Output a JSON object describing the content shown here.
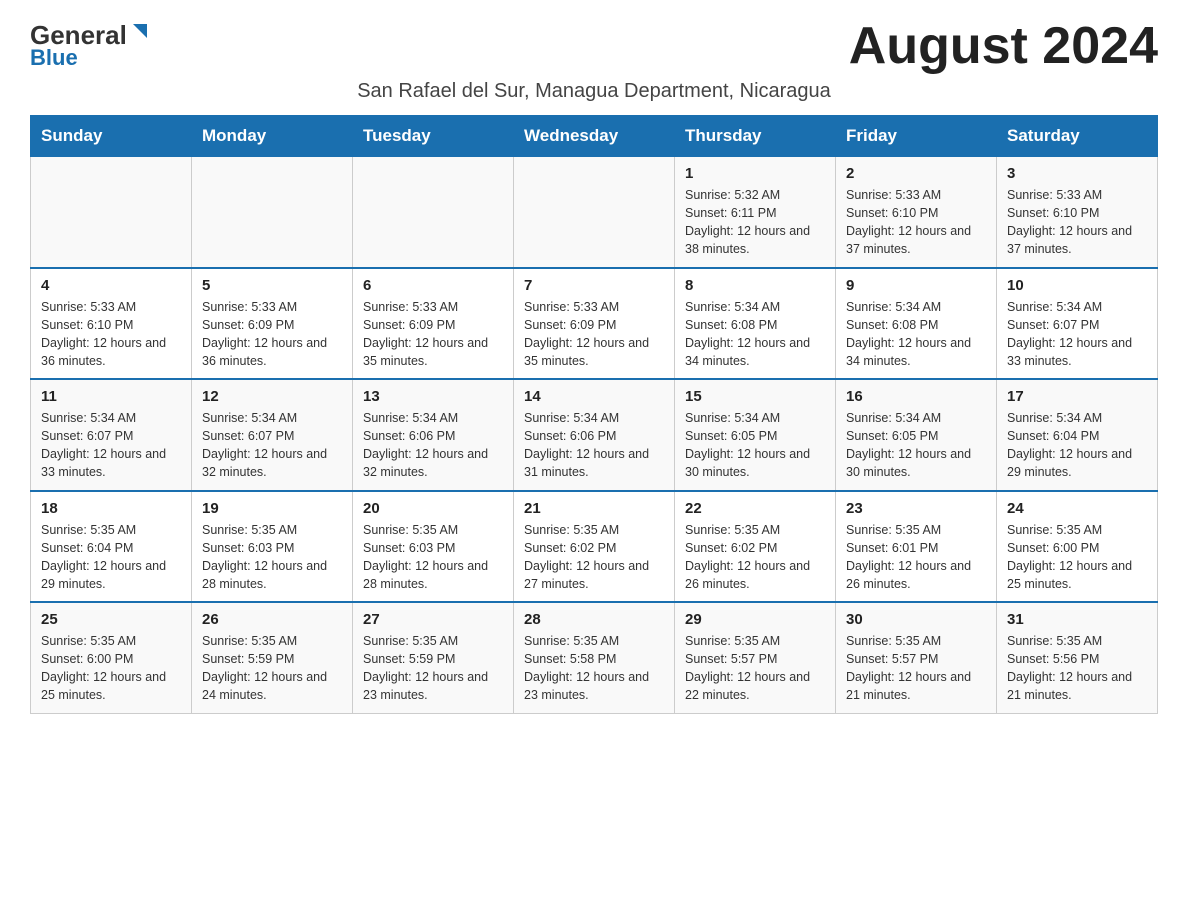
{
  "logo": {
    "general": "General",
    "blue": "Blue",
    "triangle": "▶"
  },
  "header": {
    "month_year": "August 2024",
    "location": "San Rafael del Sur, Managua Department, Nicaragua"
  },
  "weekdays": [
    "Sunday",
    "Monday",
    "Tuesday",
    "Wednesday",
    "Thursday",
    "Friday",
    "Saturday"
  ],
  "weeks": [
    [
      {
        "day": "",
        "info": ""
      },
      {
        "day": "",
        "info": ""
      },
      {
        "day": "",
        "info": ""
      },
      {
        "day": "",
        "info": ""
      },
      {
        "day": "1",
        "info": "Sunrise: 5:32 AM\nSunset: 6:11 PM\nDaylight: 12 hours and 38 minutes."
      },
      {
        "day": "2",
        "info": "Sunrise: 5:33 AM\nSunset: 6:10 PM\nDaylight: 12 hours and 37 minutes."
      },
      {
        "day": "3",
        "info": "Sunrise: 5:33 AM\nSunset: 6:10 PM\nDaylight: 12 hours and 37 minutes."
      }
    ],
    [
      {
        "day": "4",
        "info": "Sunrise: 5:33 AM\nSunset: 6:10 PM\nDaylight: 12 hours and 36 minutes."
      },
      {
        "day": "5",
        "info": "Sunrise: 5:33 AM\nSunset: 6:09 PM\nDaylight: 12 hours and 36 minutes."
      },
      {
        "day": "6",
        "info": "Sunrise: 5:33 AM\nSunset: 6:09 PM\nDaylight: 12 hours and 35 minutes."
      },
      {
        "day": "7",
        "info": "Sunrise: 5:33 AM\nSunset: 6:09 PM\nDaylight: 12 hours and 35 minutes."
      },
      {
        "day": "8",
        "info": "Sunrise: 5:34 AM\nSunset: 6:08 PM\nDaylight: 12 hours and 34 minutes."
      },
      {
        "day": "9",
        "info": "Sunrise: 5:34 AM\nSunset: 6:08 PM\nDaylight: 12 hours and 34 minutes."
      },
      {
        "day": "10",
        "info": "Sunrise: 5:34 AM\nSunset: 6:07 PM\nDaylight: 12 hours and 33 minutes."
      }
    ],
    [
      {
        "day": "11",
        "info": "Sunrise: 5:34 AM\nSunset: 6:07 PM\nDaylight: 12 hours and 33 minutes."
      },
      {
        "day": "12",
        "info": "Sunrise: 5:34 AM\nSunset: 6:07 PM\nDaylight: 12 hours and 32 minutes."
      },
      {
        "day": "13",
        "info": "Sunrise: 5:34 AM\nSunset: 6:06 PM\nDaylight: 12 hours and 32 minutes."
      },
      {
        "day": "14",
        "info": "Sunrise: 5:34 AM\nSunset: 6:06 PM\nDaylight: 12 hours and 31 minutes."
      },
      {
        "day": "15",
        "info": "Sunrise: 5:34 AM\nSunset: 6:05 PM\nDaylight: 12 hours and 30 minutes."
      },
      {
        "day": "16",
        "info": "Sunrise: 5:34 AM\nSunset: 6:05 PM\nDaylight: 12 hours and 30 minutes."
      },
      {
        "day": "17",
        "info": "Sunrise: 5:34 AM\nSunset: 6:04 PM\nDaylight: 12 hours and 29 minutes."
      }
    ],
    [
      {
        "day": "18",
        "info": "Sunrise: 5:35 AM\nSunset: 6:04 PM\nDaylight: 12 hours and 29 minutes."
      },
      {
        "day": "19",
        "info": "Sunrise: 5:35 AM\nSunset: 6:03 PM\nDaylight: 12 hours and 28 minutes."
      },
      {
        "day": "20",
        "info": "Sunrise: 5:35 AM\nSunset: 6:03 PM\nDaylight: 12 hours and 28 minutes."
      },
      {
        "day": "21",
        "info": "Sunrise: 5:35 AM\nSunset: 6:02 PM\nDaylight: 12 hours and 27 minutes."
      },
      {
        "day": "22",
        "info": "Sunrise: 5:35 AM\nSunset: 6:02 PM\nDaylight: 12 hours and 26 minutes."
      },
      {
        "day": "23",
        "info": "Sunrise: 5:35 AM\nSunset: 6:01 PM\nDaylight: 12 hours and 26 minutes."
      },
      {
        "day": "24",
        "info": "Sunrise: 5:35 AM\nSunset: 6:00 PM\nDaylight: 12 hours and 25 minutes."
      }
    ],
    [
      {
        "day": "25",
        "info": "Sunrise: 5:35 AM\nSunset: 6:00 PM\nDaylight: 12 hours and 25 minutes."
      },
      {
        "day": "26",
        "info": "Sunrise: 5:35 AM\nSunset: 5:59 PM\nDaylight: 12 hours and 24 minutes."
      },
      {
        "day": "27",
        "info": "Sunrise: 5:35 AM\nSunset: 5:59 PM\nDaylight: 12 hours and 23 minutes."
      },
      {
        "day": "28",
        "info": "Sunrise: 5:35 AM\nSunset: 5:58 PM\nDaylight: 12 hours and 23 minutes."
      },
      {
        "day": "29",
        "info": "Sunrise: 5:35 AM\nSunset: 5:57 PM\nDaylight: 12 hours and 22 minutes."
      },
      {
        "day": "30",
        "info": "Sunrise: 5:35 AM\nSunset: 5:57 PM\nDaylight: 12 hours and 21 minutes."
      },
      {
        "day": "31",
        "info": "Sunrise: 5:35 AM\nSunset: 5:56 PM\nDaylight: 12 hours and 21 minutes."
      }
    ]
  ]
}
